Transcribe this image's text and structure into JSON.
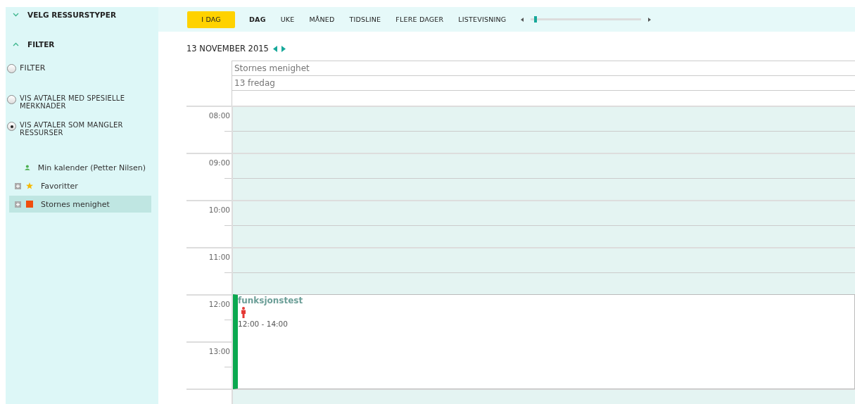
{
  "sidebar": {
    "sections": [
      {
        "title": "VELG RESSURSTYPER",
        "expanded": false
      },
      {
        "title": "FILTER",
        "expanded": true
      }
    ],
    "filters": [
      {
        "label": "FILTER",
        "selected": false
      },
      {
        "label": "VIS AVTALER MED SPESIELLE MERKNADER",
        "selected": false
      },
      {
        "label": "VIS AVTALER SOM MANGLER RESSURSER",
        "selected": true
      }
    ],
    "calendars": [
      {
        "label": "Min kalender (Petter Nilsen)",
        "kind": "person",
        "expandable": false,
        "selected": false,
        "color": "#4caf50"
      },
      {
        "label": "Favoritter",
        "kind": "star",
        "expandable": true,
        "selected": false,
        "color": "#f5b800"
      },
      {
        "label": "Stornes menighet",
        "kind": "square",
        "expandable": true,
        "selected": true,
        "color": "#f04e0c"
      }
    ]
  },
  "toolbar": {
    "today": "I DAG",
    "views": [
      {
        "label": "DAG",
        "selected": true
      },
      {
        "label": "UKE",
        "selected": false
      },
      {
        "label": "MÅNED",
        "selected": false
      },
      {
        "label": "TIDSLINE",
        "selected": false
      },
      {
        "label": "FLERE DAGER",
        "selected": false
      },
      {
        "label": "LISTEVISNING",
        "selected": false
      }
    ],
    "zoom": {
      "level": 0.03
    }
  },
  "calendar": {
    "date": "13 NOVEMBER 2015",
    "resource": "Stornes menighet",
    "day": "13 fredag",
    "hours": [
      "08:00",
      "09:00",
      "10:00",
      "11:00",
      "12:00",
      "13:00"
    ],
    "events": [
      {
        "title": "funksjonstest",
        "time": "12:00 - 14:00",
        "color": "#0aa84f"
      }
    ]
  }
}
